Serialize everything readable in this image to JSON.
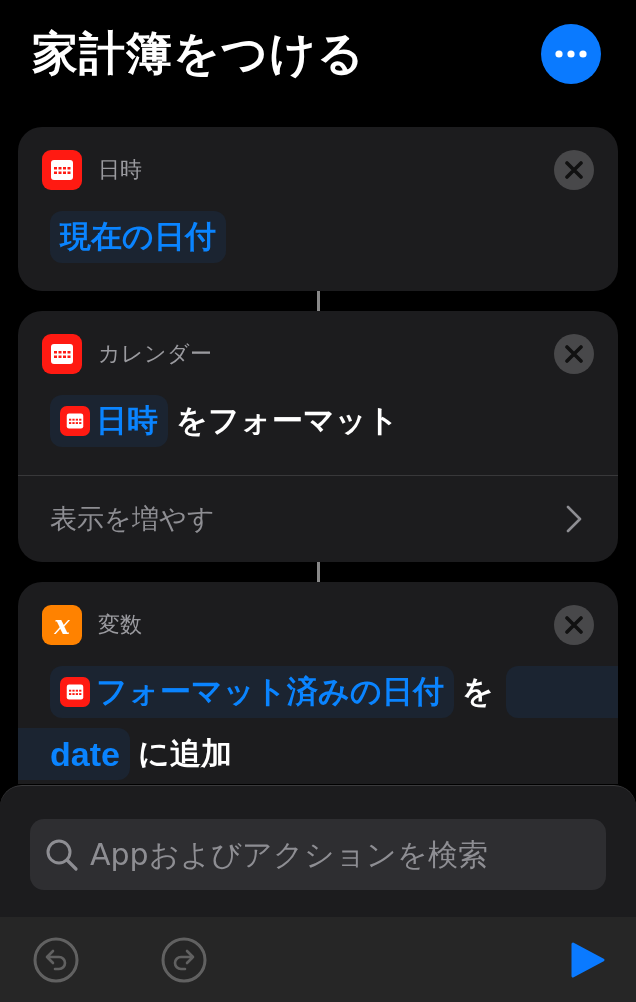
{
  "title": "家計簿をつける",
  "actions": [
    {
      "kind": "calendar",
      "category": "日時",
      "lines": [
        [
          {
            "kind": "pill",
            "text": "現在の日付"
          }
        ]
      ]
    },
    {
      "kind": "calendar",
      "category": "カレンダー",
      "lines": [
        [
          {
            "kind": "calendar_pill",
            "text": "日時"
          },
          {
            "kind": "text",
            "text": "をフォーマット"
          }
        ]
      ],
      "show_more": "表示を増やす"
    },
    {
      "kind": "variable",
      "icon_text": "x",
      "category": "変数",
      "lines": [
        [
          {
            "kind": "calendar_pill",
            "text": "フォーマット済みの日付"
          },
          {
            "kind": "text",
            "text": "を"
          },
          {
            "kind": "blank"
          }
        ],
        [
          {
            "kind": "wrapped_pill",
            "text": "date"
          },
          {
            "kind": "text",
            "text": "に追加"
          }
        ]
      ]
    }
  ],
  "search": {
    "placeholder": "Appおよびアクションを検索"
  },
  "toolbar": [
    {
      "kind": "undo",
      "disabled": true
    },
    {
      "kind": "redo",
      "disabled": true
    }
  ]
}
